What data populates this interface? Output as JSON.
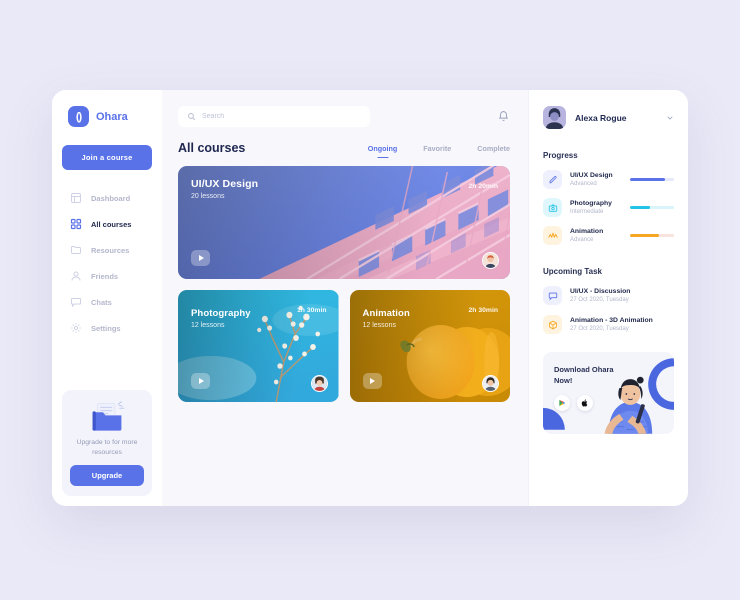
{
  "brand": {
    "logo_glyph": "()",
    "name": "Ohara",
    "logo_icon": "ohara-logo-icon"
  },
  "sidebar": {
    "join_button": "Join a course",
    "nav": [
      {
        "label": "Dashboard",
        "icon": "dashboard-icon",
        "active": false
      },
      {
        "label": "All courses",
        "icon": "grid-icon",
        "active": true
      },
      {
        "label": "Resources",
        "icon": "folder-icon",
        "active": false
      },
      {
        "label": "Friends",
        "icon": "user-icon",
        "active": false
      },
      {
        "label": "Chats",
        "icon": "chat-icon",
        "active": false
      },
      {
        "label": "Settings",
        "icon": "gear-icon",
        "active": false
      }
    ],
    "upgrade": {
      "text": "Upgrade to  for more resources",
      "button": "Upgrade",
      "illustration": "folder-documents-illustration"
    }
  },
  "search": {
    "placeholder": "Search",
    "value": "",
    "icon": "search-icon"
  },
  "notifications": {
    "icon": "bell-icon"
  },
  "main": {
    "title": "All courses",
    "tabs": [
      {
        "label": "Ongoing",
        "active": true
      },
      {
        "label": "Favorite",
        "active": false
      },
      {
        "label": "Complete",
        "active": false
      }
    ],
    "courses": [
      {
        "title": "UI/UX Design",
        "lessons": "20 lessons",
        "duration": "2h 20min",
        "image": "pink-building-facade",
        "accent": "#6c86e0"
      },
      {
        "title": "Photography",
        "lessons": "12 lessons",
        "duration": "1h 30min",
        "image": "blossom-branch-blue-sky",
        "accent": "#28b6e0"
      },
      {
        "title": "Animation",
        "lessons": "12 lessons",
        "duration": "2h 30min",
        "image": "orange-citrus-slices",
        "accent": "#d99406"
      }
    ]
  },
  "user": {
    "name": "Alexa Rogue",
    "avatar": "user-avatar",
    "menu_icon": "chevron-down-icon"
  },
  "progress": {
    "heading": "Progress",
    "items": [
      {
        "name": "UI/UX Design",
        "level": "Advanced",
        "percent": 80,
        "color": "#5a72e8",
        "track": "#e6e9fb",
        "icon": "pencil-icon",
        "icon_bg": "#eef0fd"
      },
      {
        "name": "Photography",
        "level": "Intermediate",
        "percent": 45,
        "color": "#22c3e6",
        "track": "#d9f4fa",
        "icon": "camera-icon",
        "icon_bg": "#dff7fc"
      },
      {
        "name": "Animation",
        "level": "Advance",
        "percent": 65,
        "color": "#f5a623",
        "track": "#fbe3dd",
        "icon": "waveform-icon",
        "icon_bg": "#fef3de"
      }
    ]
  },
  "upcoming": {
    "heading": "Upcoming Task",
    "items": [
      {
        "name": "UI/UX - Discussion",
        "date": "27 Oct 2020, Tuesday",
        "icon": "chat-bubble-icon",
        "icon_bg": "#eef0fd",
        "icon_color": "#5a72e8"
      },
      {
        "name": "Animation - 3D Animation",
        "date": "27 Oct 2020, Tuesday",
        "icon": "cube-icon",
        "icon_bg": "#fef3de",
        "icon_color": "#f5a623"
      }
    ]
  },
  "promo": {
    "title": "Download Ohara Now!",
    "stores": [
      {
        "name": "google-play-icon"
      },
      {
        "name": "apple-icon"
      }
    ],
    "illustration": "woman-with-phone-illustration"
  }
}
